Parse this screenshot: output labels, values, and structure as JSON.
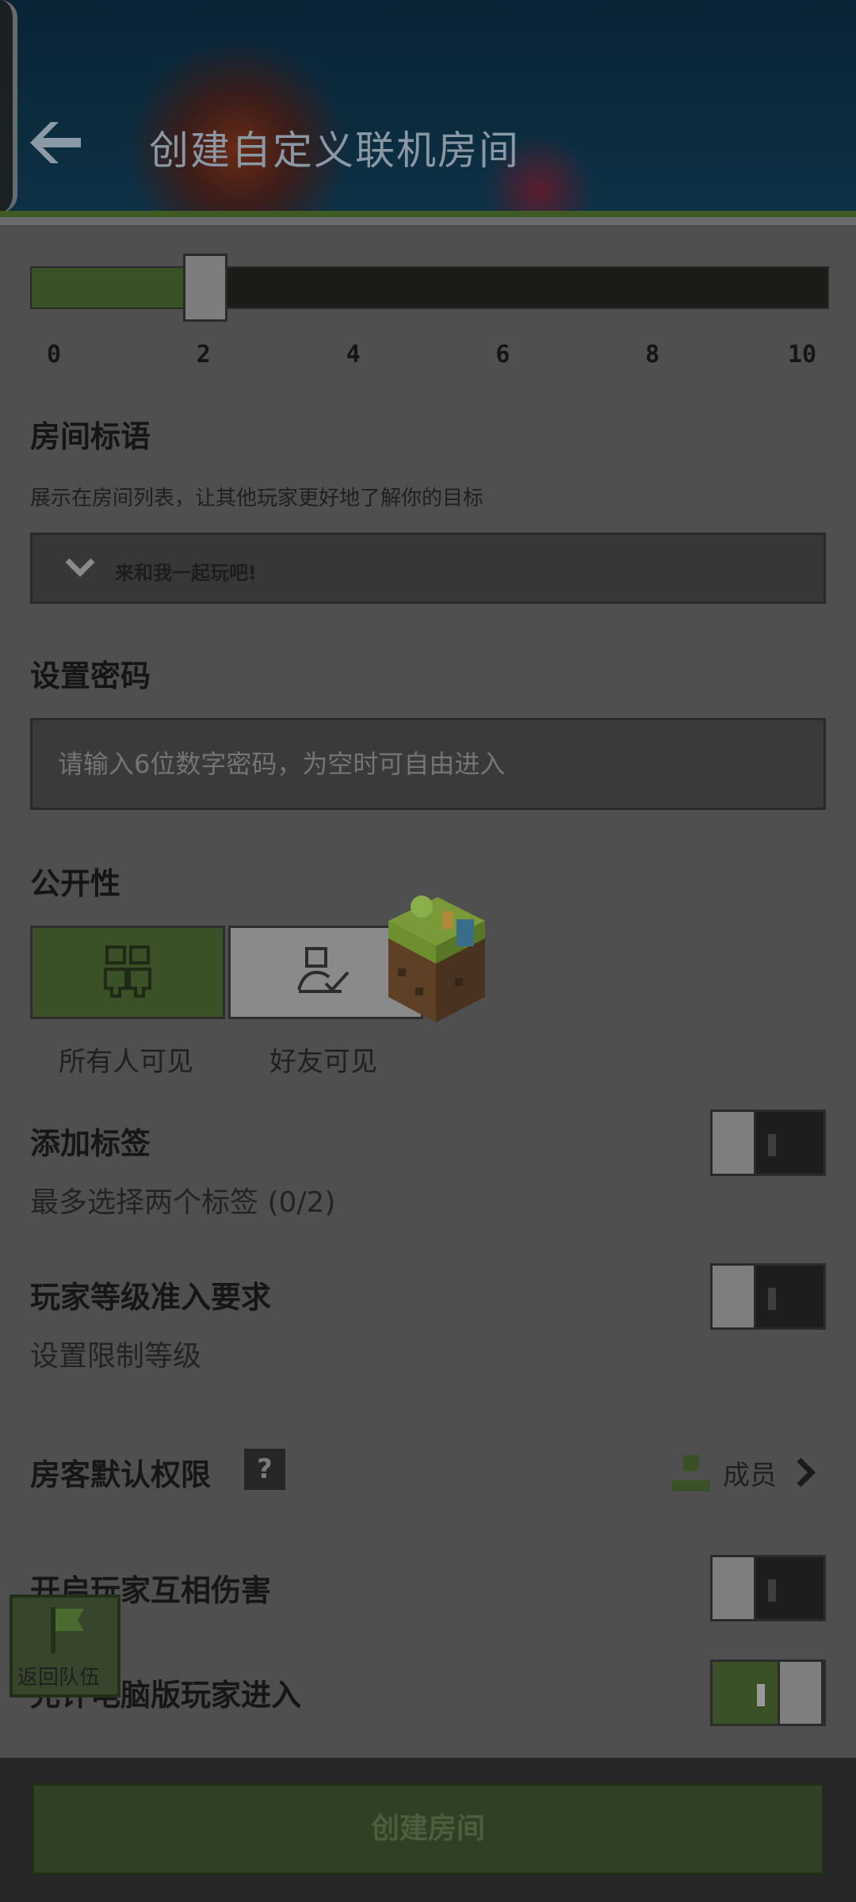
{
  "header": {
    "title": "创建自定义联机房间",
    "back_icon": "arrow-left-icon"
  },
  "slider": {
    "ticks": [
      "0",
      "2",
      "4",
      "6",
      "8",
      "10"
    ],
    "value": 2,
    "max": 10,
    "fill_color": "#3a5128"
  },
  "room_slogan": {
    "title": "房间标语",
    "description": "展示在房间列表，让其他玩家更好地了解你的目标",
    "selected": "来和我一起玩吧!"
  },
  "password": {
    "title": "设置密码",
    "placeholder": "请输入6位数字密码，为空时可自由进入"
  },
  "visibility": {
    "title": "公开性",
    "options": [
      {
        "label": "所有人可见",
        "icon": "group-icon",
        "selected": true
      },
      {
        "label": "好友可见",
        "icon": "friend-icon",
        "selected": false
      }
    ]
  },
  "tags": {
    "title": "添加标签",
    "subtitle": "最多选择两个标签 (0/2)",
    "enabled": false
  },
  "level_requirement": {
    "title": "玩家等级准入要求",
    "subtitle": "设置限制等级",
    "enabled": false
  },
  "guest_permission": {
    "title": "房客默认权限",
    "help": "?",
    "value": "成员"
  },
  "pvp": {
    "title": "开启玩家互相伤害",
    "enabled": false
  },
  "pc_players": {
    "title": "允许电脑版玩家进入",
    "enabled": true
  },
  "return_team": {
    "label": "返回队伍"
  },
  "create_button": {
    "label": "创建房间"
  },
  "colors": {
    "accent_green": "#3a5128",
    "overlay_gray": "#4f4f4f"
  }
}
